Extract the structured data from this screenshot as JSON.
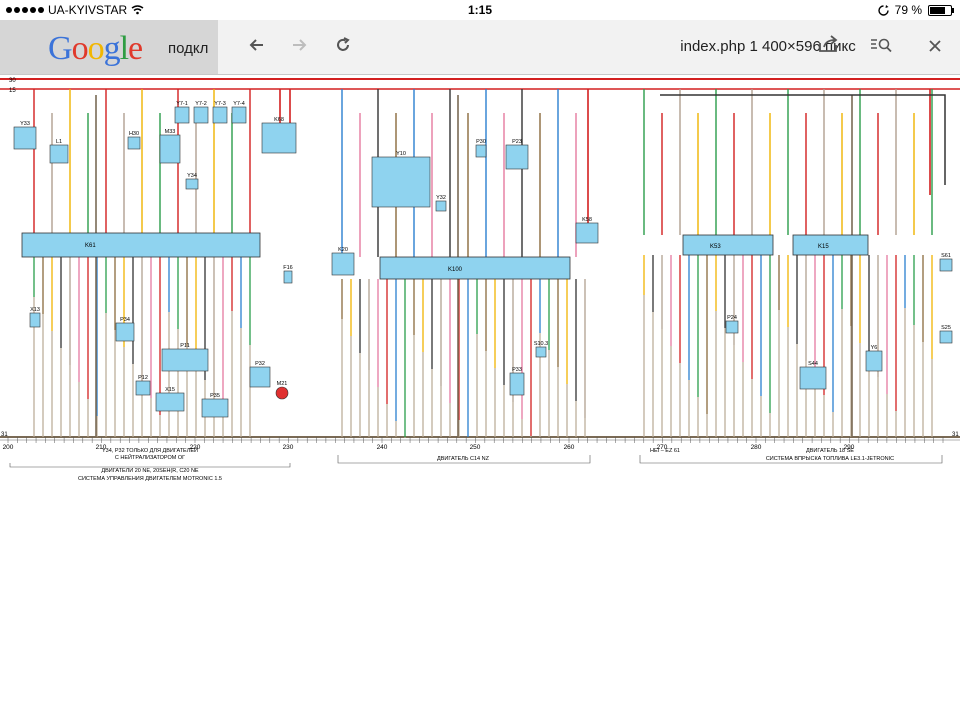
{
  "status_bar": {
    "carrier": "UA-KYIVSTAR",
    "time": "1:15",
    "battery": "79 %",
    "battery_level": 0.79
  },
  "browser": {
    "google_logo": "Google",
    "tab_label": "подкл",
    "page_title": "index.php 1 400×596 пикс"
  },
  "diagram": {
    "bus_labels": {
      "top1": "30",
      "top2": "15",
      "bottom": "31"
    },
    "sections": [
      {
        "id": "s1",
        "block": "K61",
        "caption": "ДВИГАТЕЛИ 20 NE, 20SEH(R, C20 NE",
        "caption2": "СИСТЕМА УПРАВЛЕНИЯ ДВИГАТЕЛЕМ MOTRONIC 1.5",
        "note": "Y34, P32 ТОЛЬКО ДЛЯ ДВИГАТЕЛЕЙ",
        "note2": "С НЕЙТРАЛИЗАТОРОМ ОГ"
      },
      {
        "id": "s2",
        "block": "K100",
        "caption": "ДВИГАТЕЛЬ C14 NZ"
      },
      {
        "id": "s3",
        "block": "K53",
        "block2": "K15",
        "caption_left": "HEI – EZ 61",
        "caption": "ДВИГАТЕЛЬ 18 SE",
        "caption2": "СИСТЕМА ВПРЫСКА ТОПЛИВА LE3.1-JETRONIC"
      }
    ],
    "ruler": [
      "200",
      "210",
      "220",
      "230",
      "240",
      "250",
      "260",
      "270",
      "280",
      "290"
    ],
    "components": [
      "Y33",
      "L1",
      "H30",
      "M33",
      "Y7-1",
      "Y7-2",
      "Y7-3",
      "Y7-4",
      "K68",
      "Y34",
      "F16",
      "X13",
      "P34",
      "P11",
      "P12",
      "X15",
      "P35",
      "P32",
      "M21",
      "K20",
      "Y10",
      "Y32",
      "P30",
      "P23",
      "K58",
      "S10.3",
      "P33",
      "S61",
      "S25",
      "P24",
      "S44",
      "Y6"
    ]
  }
}
